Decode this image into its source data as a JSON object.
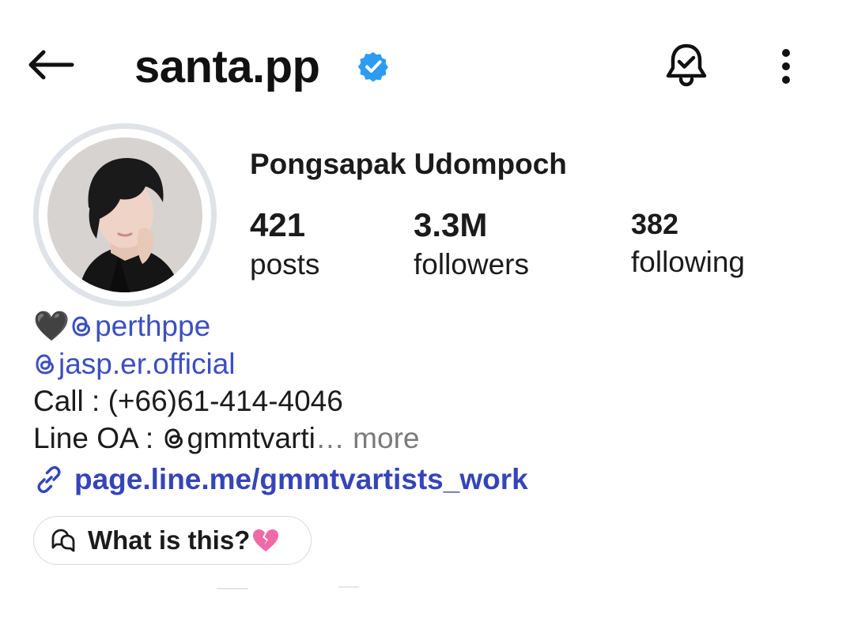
{
  "header": {
    "username": "santa.pp",
    "verified_icon": "verified-badge-icon",
    "back_icon": "back-arrow-icon",
    "bell_icon": "notification-bell-check-icon",
    "more_icon": "more-vertical-icon"
  },
  "profile": {
    "full_name": "Pongsapak Udompoch",
    "avatar_icon": "profile-photo"
  },
  "stats": {
    "posts": {
      "value": "421",
      "label": "posts"
    },
    "followers": {
      "value": "3.3M",
      "label": "followers"
    },
    "following": {
      "value": "382",
      "label": "following"
    }
  },
  "bio": {
    "line1_emoji": "🖤",
    "line1_mention": "perthppe",
    "line2_mention": "jasp.er.official",
    "line3": "Call : (+66)61-414-4046",
    "line4_prefix": "Line OA : ",
    "line4_mention_partial": "gmmtvarti",
    "line4_ellipsis": "…",
    "more_label": " more",
    "link_text": "page.line.me/gmmtvartists_work"
  },
  "chip": {
    "label": "What is this?",
    "emoji_icon": "broken-heart-icon"
  },
  "colors": {
    "mention": "#3c4fc0",
    "link": "#3545b8",
    "verified": "#2d9bf0",
    "more": "#7a7a7a",
    "broken_heart": "#f06aa7"
  }
}
